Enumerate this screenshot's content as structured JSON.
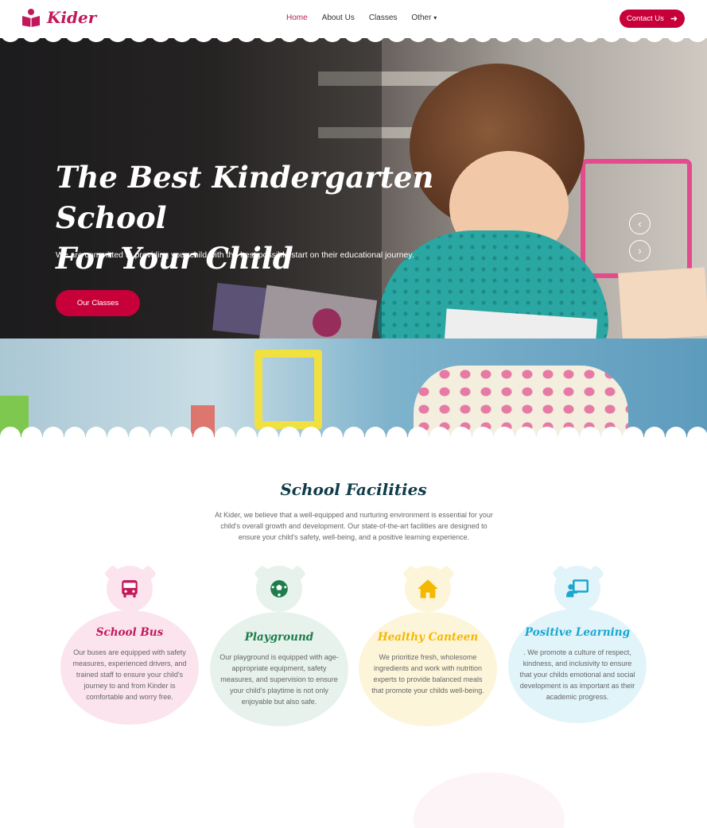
{
  "brand": {
    "name": "Kider",
    "accent": "#c70039"
  },
  "nav": {
    "items": [
      {
        "label": "Home",
        "active": true
      },
      {
        "label": "About Us"
      },
      {
        "label": "Classes"
      },
      {
        "label": "Other"
      }
    ],
    "contact_label": "Contact Us"
  },
  "hero": {
    "title_line1": "The Best Kindergarten School",
    "title_line2": "For Your Child",
    "subtitle": "We are committed to providing your child with the best possible start on their educational journey.",
    "button_label": "Our Classes",
    "prev_icon": "‹",
    "next_icon": "›"
  },
  "facilities": {
    "title": "School Facilities",
    "description": "At Kider, we believe that a well-equipped and nurturing environment is essential for your child's overall growth and development. Our state-of-the-art facilities are designed to ensure your child's safety, well-being, and a positive learning experience.",
    "cards": [
      {
        "title": "School Bus",
        "icon": "bus-icon",
        "color": "#c2185b",
        "bg": "#fbe4ee",
        "text": "Our buses are equipped with safety measures, experienced drivers, and trained staff to ensure your child's journey to and from Kinder is comfortable and worry free."
      },
      {
        "title": "Playground",
        "icon": "football-icon",
        "color": "#1e7d4b",
        "bg": "#e7f2ec",
        "text": "Our playground is equipped with age-appropriate equipment, safety measures, and supervision to ensure your child's playtime is not only enjoyable but also safe."
      },
      {
        "title": "Healthy Canteen",
        "icon": "home-icon",
        "color": "#f5b800",
        "bg": "#fdf5da",
        "text": "We prioritize fresh, wholesome ingredients and work with nutrition experts to provide balanced meals that promote your childs well-being."
      },
      {
        "title": "Positive Learning",
        "icon": "teacher-icon",
        "color": "#1aa6cf",
        "bg": "#e1f4fa",
        "text": ". We promote a culture of respect, kindness, and inclusivity to ensure that your childs emotional and social development is as important as their academic progress."
      }
    ]
  }
}
